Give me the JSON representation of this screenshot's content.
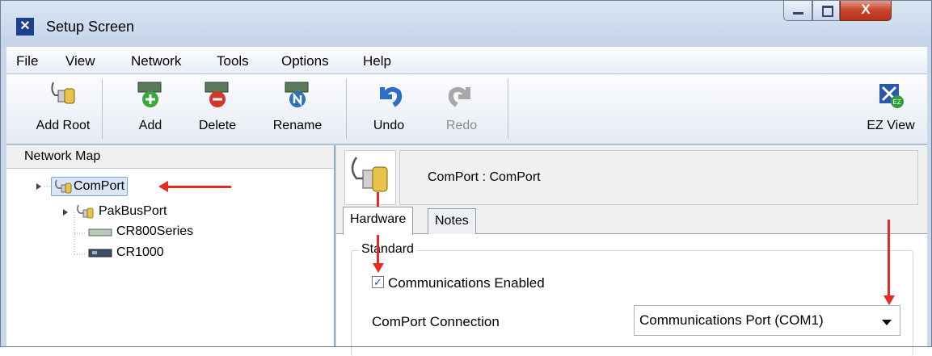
{
  "window": {
    "title": "Setup Screen",
    "app_icon": "setup-screen-app-icon",
    "close_glyph": "X"
  },
  "menu": [
    {
      "label": "File"
    },
    {
      "label": "View"
    },
    {
      "label": "Network"
    },
    {
      "label": "Tools"
    },
    {
      "label": "Options"
    },
    {
      "label": "Help"
    }
  ],
  "toolbar": {
    "add_root": "Add Root",
    "add": "Add",
    "delete": "Delete",
    "rename": "Rename",
    "undo": "Undo",
    "redo": "Redo",
    "ez_view": "EZ View"
  },
  "network_map": {
    "title": "Network Map",
    "items": [
      {
        "label": "ComPort",
        "level": 0,
        "selected": true,
        "icon": "comport-icon"
      },
      {
        "label": "PakBusPort",
        "level": 1,
        "icon": "pakbusport-icon"
      },
      {
        "label": "CR800Series",
        "level": 2,
        "icon": "datalogger-icon"
      },
      {
        "label": "CR1000",
        "level": 2,
        "icon": "datalogger-icon"
      }
    ]
  },
  "detail": {
    "header_name": "ComPort : ComPort",
    "tabs": [
      {
        "label": "Hardware",
        "active": true
      },
      {
        "label": "Notes",
        "active": false
      }
    ],
    "group_label": "Standard",
    "comms_enabled_label": "Communications Enabled",
    "comms_enabled_checked": true,
    "check_glyph": "✓",
    "connection_label": "ComPort Connection",
    "connection_value": "Communications Port (COM1)"
  },
  "colors": {
    "annotation_arrow": "#e32b20",
    "close_button": "#c7452c",
    "title_bar": "#c3d4e9"
  }
}
